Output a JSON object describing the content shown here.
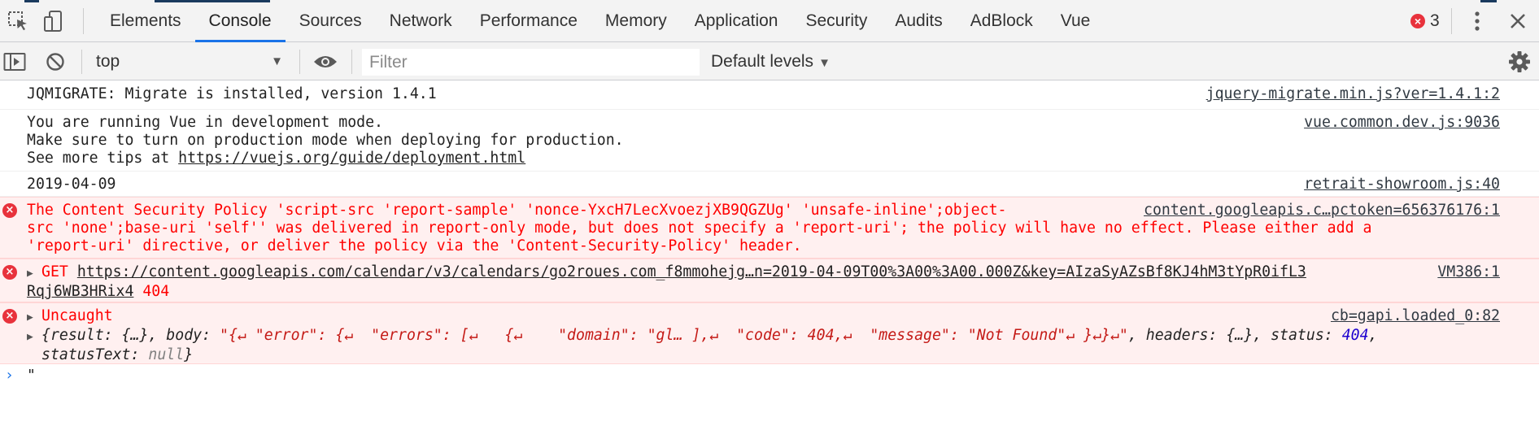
{
  "devtools": {
    "tabs": [
      "Elements",
      "Console",
      "Sources",
      "Network",
      "Performance",
      "Memory",
      "Application",
      "Security",
      "Audits",
      "AdBlock",
      "Vue"
    ],
    "active_tab": "Console",
    "error_count": "3",
    "icons": [
      "inspect-element-icon",
      "device-toolbar-icon",
      "more-menu-icon",
      "close-icon"
    ]
  },
  "toolbar": {
    "context": "top",
    "filter_placeholder": "Filter",
    "filter_value": "",
    "levels": "Default levels"
  },
  "messages": [
    {
      "text": "JQMIGRATE: Migrate is installed, version 1.4.1",
      "source": "jquery-migrate.min.js?ver=1.4.1:2"
    },
    {
      "line1": "You are running Vue in development mode.",
      "line2": "Make sure to turn on production mode when deploying for production.",
      "line3_prefix": "See more tips at ",
      "line3_link": "https://vuejs.org/guide/deployment.html",
      "source": "vue.common.dev.js:9036"
    },
    {
      "text": "2019-04-09",
      "source": "retrait-showroom.js:40"
    },
    {
      "line1": "The Content Security Policy 'script-src 'report-sample' 'nonce-YxcH7LecXvoezjXB9QGZUg' 'unsafe-inline';object-",
      "line2": "src 'none';base-uri 'self'' was delivered in report-only mode, but does not specify a 'report-uri'; the policy will have no effect. Please either add a",
      "line3": "'report-uri' directive, or deliver the policy via the 'Content-Security-Policy' header.",
      "source": "content.googleapis.c…pctoken=656376176:1"
    },
    {
      "method": "GET",
      "url_line1": "https://content.googleapis.com/calendar/v3/calendars/go2roues.com_f8mmohejg…n=2019-04-09T00%3A00%3A00.000Z&key=AIzaSyAZsBf8KJ4hM3tYpR0ifL3",
      "url_line2": "Rqj6WB3HRix4",
      "status": "404",
      "source": "VM386:1"
    },
    {
      "label": "Uncaught",
      "source": "cb=gapi.loaded_0:82",
      "obj_prefix": "{result: {…}, body: ",
      "obj_body": "\"{↵ \"error\": {↵  \"errors\": [↵   {↵    \"domain\": \"gl… ],↵  \"code\": 404,↵  \"message\": \"Not Found\"↵ }↵}↵\"",
      "obj_headers": ", headers: {…}, status: ",
      "obj_status": "404",
      "obj_tail": ",",
      "obj_line2_key": "statusText: ",
      "obj_line2_val": "null",
      "obj_line2_end": "}"
    }
  ],
  "prompt": {
    "input": "\""
  }
}
